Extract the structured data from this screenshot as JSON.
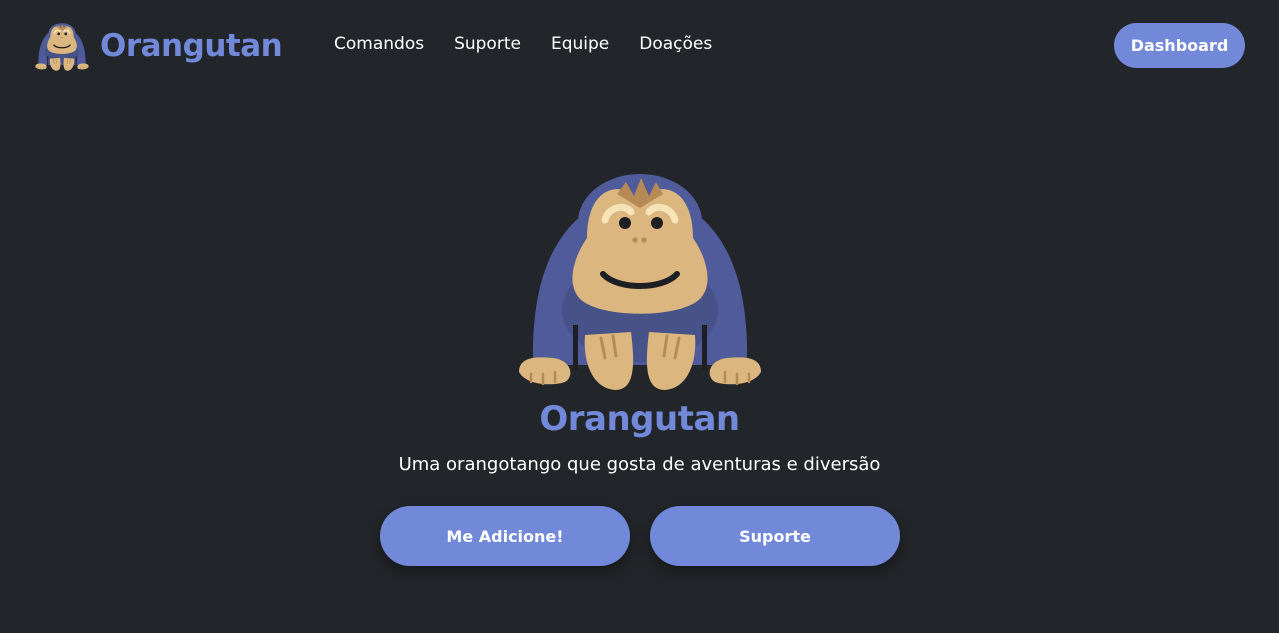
{
  "colors": {
    "background": "#222529",
    "accent": "#7289da",
    "fur": "#4f5b9b",
    "skin": "#dcb67f"
  },
  "navbar": {
    "brand_name": "Orangutan",
    "brand_icon": "orangutan-logo-icon",
    "links": [
      "Comandos",
      "Suporte",
      "Equipe",
      "Doações"
    ],
    "dashboard_label": "Dashboard"
  },
  "hero": {
    "mascot_icon": "orangutan-mascot-icon",
    "title": "Orangutan",
    "subtitle": "Uma orangotango que gosta de aventuras e diversão",
    "buttons": {
      "add_label": "Me Adicione!",
      "support_label": "Suporte"
    }
  }
}
